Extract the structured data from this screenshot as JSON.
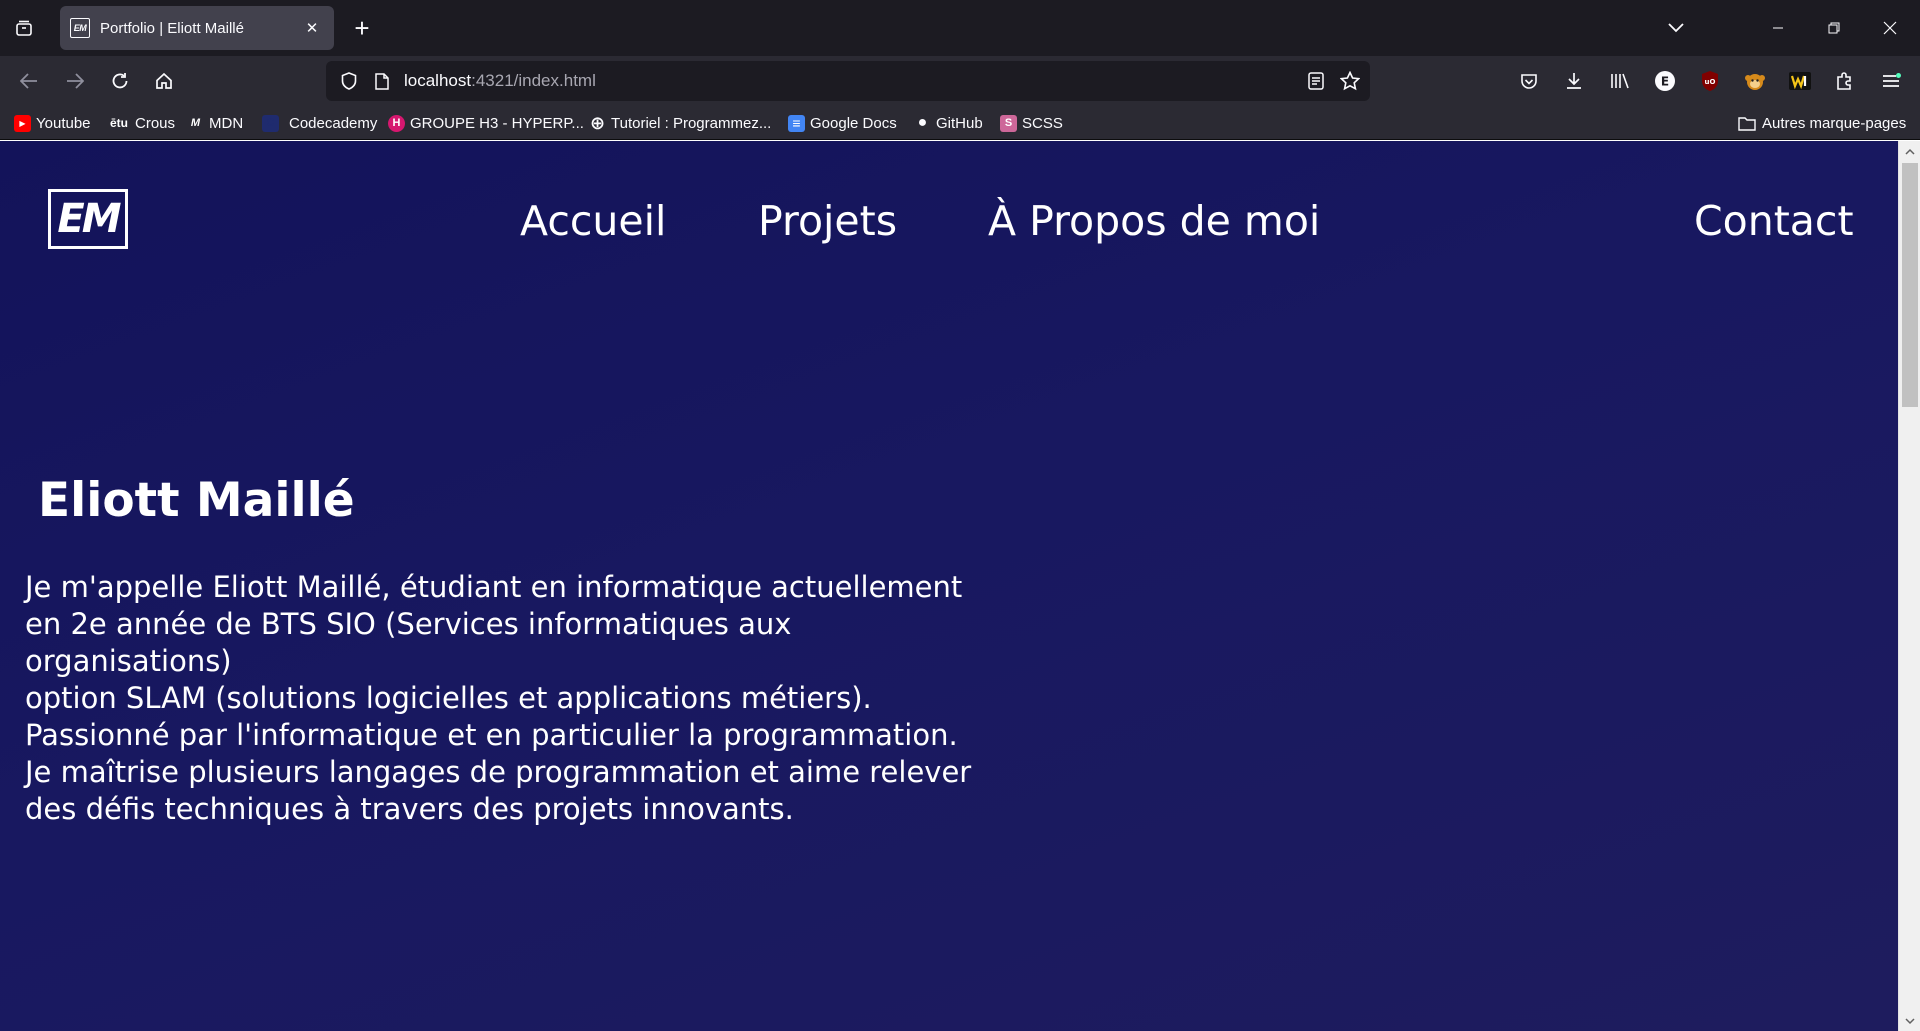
{
  "browser": {
    "tab": {
      "favicon_text": "EM",
      "title": "Portfolio | Eliott Maillé",
      "close_glyph": "✕"
    },
    "new_tab_glyph": "+",
    "url": {
      "host": "localhost",
      "path": ":4321/index.html"
    },
    "bookmarks": [
      {
        "label": "Youtube",
        "icon": "youtube-icon",
        "icon_text": "▶",
        "color": "#ff0000"
      },
      {
        "label": "Crous",
        "icon": "etu-icon",
        "icon_text": "ētu",
        "color": "#ffffff"
      },
      {
        "label": "MDN",
        "icon": "mdn-icon",
        "icon_text": "M",
        "color": "#ffffff"
      },
      {
        "label": "Codecademy",
        "icon": "codecademy-icon",
        "icon_text": "C",
        "color": "#1f2b6e"
      },
      {
        "label": "GROUPE H3 - HYPERP...",
        "icon": "hyperplanning-icon",
        "icon_text": "H",
        "color": "#d6176f"
      },
      {
        "label": "Tutoriel : Programmez...",
        "icon": "globe-icon",
        "icon_text": "⊕",
        "color": "#fbfbfe"
      },
      {
        "label": "Google Docs",
        "icon": "google-docs-icon",
        "icon_text": "≡",
        "color": "#4285f4"
      },
      {
        "label": "GitHub",
        "icon": "github-icon",
        "icon_text": "●",
        "color": "#fbfbfe"
      },
      {
        "label": "SCSS",
        "icon": "sass-icon",
        "icon_text": "S",
        "color": "#cd6799"
      }
    ],
    "other_bookmarks": "Autres marque-pages"
  },
  "site": {
    "logo_text": "EM",
    "nav": {
      "home": "Accueil",
      "projects": "Projets",
      "about": "À Propos de moi",
      "contact": "Contact"
    },
    "hero": {
      "name": "Eliott Maillé",
      "bio_line1": "Je m'appelle Eliott Maillé, étudiant en informatique actuellement en 2e année de BTS SIO (Services informatiques aux organisations)",
      "bio_line2": "option SLAM (solutions logicielles et applications métiers). Passionné par l'informatique et en particulier la programmation. Je maîtrise plusieurs langages de programmation et aime relever des défis techniques à travers des projets innovants."
    }
  },
  "colors": {
    "page_bg": "#161660",
    "chrome_bg": "#1c1b22",
    "toolbar_bg": "#2b2a33",
    "text": "#ffffff"
  }
}
